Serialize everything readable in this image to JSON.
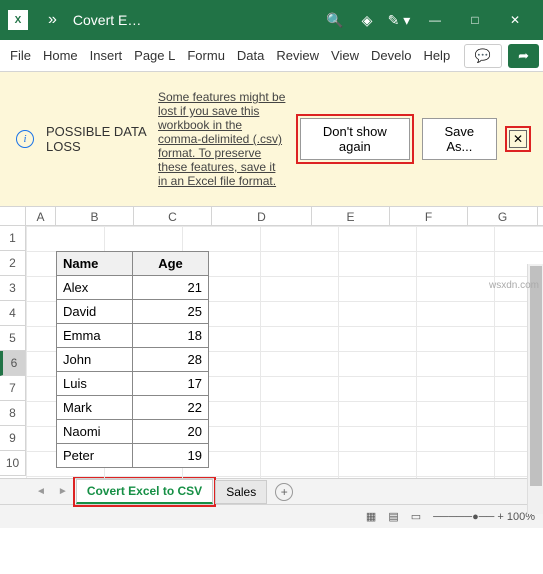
{
  "title_bar": {
    "app_icon": "X",
    "quick_dropdown": "»",
    "doc_name": "Covert E…",
    "search_icon": "🔍",
    "diamond_icon": "◈",
    "draw_icon": "✎ ▾"
  },
  "window": {
    "minimize": "—",
    "maximize": "□",
    "close": "✕"
  },
  "ribbon": {
    "tabs": [
      "File",
      "Home",
      "Insert",
      "Page L",
      "Formu",
      "Data",
      "Review",
      "View",
      "Develo",
      "Help"
    ],
    "comment_icon": "💬",
    "share_icon": "➦"
  },
  "message_bar": {
    "info": "i",
    "title": "POSSIBLE DATA LOSS",
    "text": "Some features might be lost if you save this workbook in the comma-delimited (.csv) format. To preserve these features, save it in an Excel file format.",
    "btn_dont_show": "Don't show again",
    "btn_save_as": "Save As...",
    "close": "✕"
  },
  "columns": [
    "A",
    "B",
    "C",
    "D",
    "E",
    "F",
    "G"
  ],
  "rows": [
    "1",
    "2",
    "3",
    "4",
    "5",
    "6",
    "7",
    "8",
    "9",
    "10"
  ],
  "table": {
    "headers": {
      "name": "Name",
      "age": "Age"
    },
    "data": [
      {
        "name": "Alex",
        "age": "21"
      },
      {
        "name": "David",
        "age": "25"
      },
      {
        "name": "Emma",
        "age": "18"
      },
      {
        "name": "John",
        "age": "28"
      },
      {
        "name": "Luis",
        "age": "17"
      },
      {
        "name": "Mark",
        "age": "22"
      },
      {
        "name": "Naomi",
        "age": "20"
      },
      {
        "name": "Peter",
        "age": "19"
      }
    ]
  },
  "sheets": {
    "active": "Covert Excel to CSV",
    "other": "Sales",
    "new": "+"
  },
  "status": {
    "zoom": "─────●── + 100%"
  },
  "watermark": "wsxdn.com"
}
